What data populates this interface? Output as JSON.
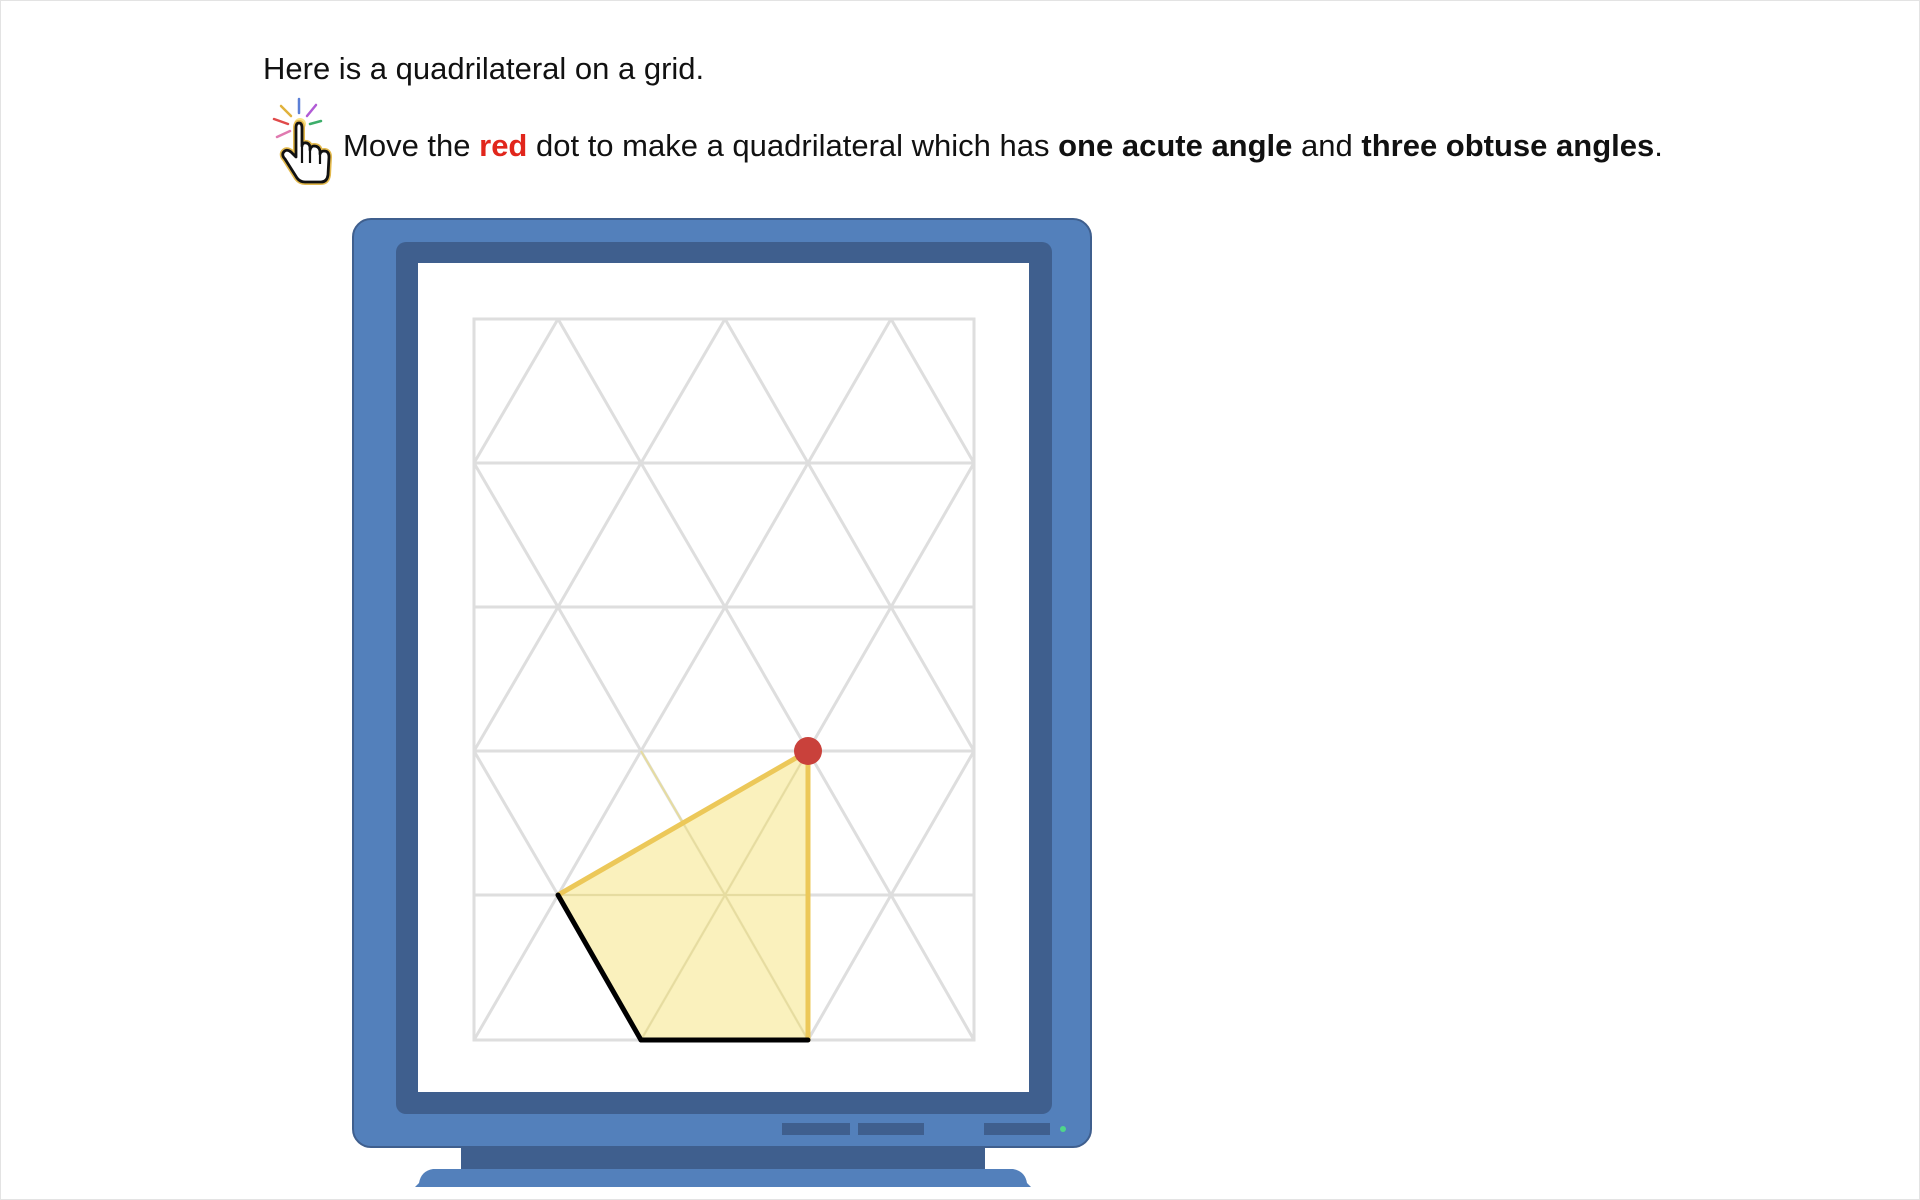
{
  "intro_text": "Here is a quadrilateral on a grid.",
  "instruction": {
    "part1": "Move the ",
    "red_word": "red",
    "part2": " dot to make a quadrilateral which has ",
    "bold1": "one acute angle",
    "part3": " and ",
    "bold2": "three obtuse angles",
    "part4": "."
  },
  "icons": {
    "hand": "pointing-hand-icon"
  },
  "colors": {
    "frame": "#5380bb",
    "bezel": "#3f5f8e",
    "grid": "#dedede",
    "shape_fill": "#f9efb2",
    "shape_stroke": "#ecc859",
    "fixed_edge": "#000000",
    "dot": "#c9413b",
    "red_text": "#e1261c"
  }
}
